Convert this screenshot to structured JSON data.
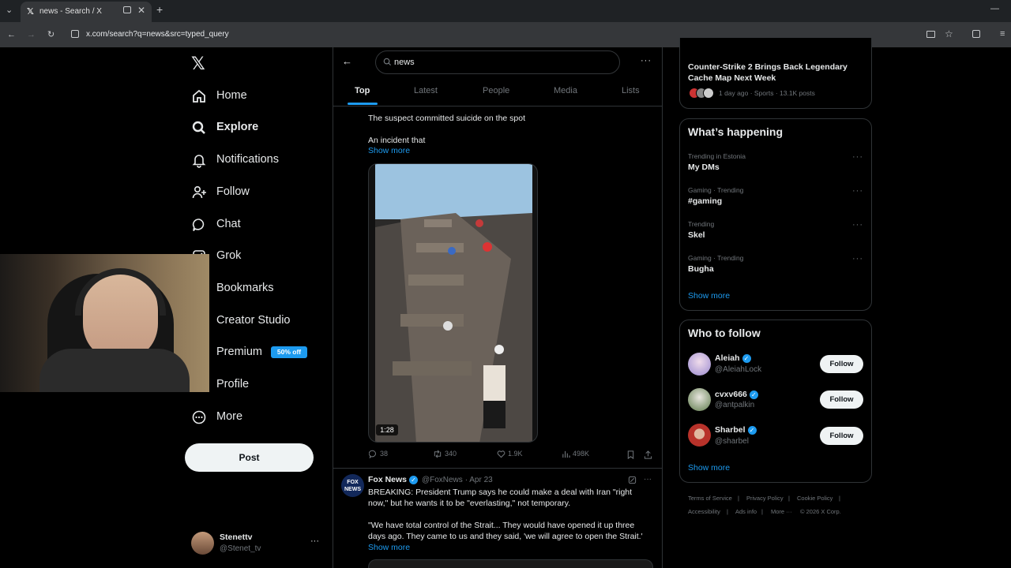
{
  "browser": {
    "tab_title": "news - Search / X",
    "url": "x.com/search?q=news&src=typed_query"
  },
  "nav": {
    "items": [
      {
        "label": "Home",
        "icon": "home-icon"
      },
      {
        "label": "Explore",
        "icon": "search-icon"
      },
      {
        "label": "Notifications",
        "icon": "bell-icon"
      },
      {
        "label": "Follow",
        "icon": "add-person-icon"
      },
      {
        "label": "Chat",
        "icon": "chat-icon"
      },
      {
        "label": "Grok",
        "icon": "grok-icon"
      },
      {
        "label": "Bookmarks",
        "icon": "bookmark-icon"
      },
      {
        "label": "Creator Studio",
        "icon": "creator-studio-icon"
      },
      {
        "label": "Premium",
        "icon": "x-logo-icon"
      },
      {
        "label": "Profile",
        "icon": "person-icon"
      },
      {
        "label": "More",
        "icon": "more-circle-icon"
      }
    ],
    "premium_badge": "50% off",
    "post_button": "Post",
    "account": {
      "name": "Stenettv",
      "handle": "@Stenet_tv",
      "more": "···"
    }
  },
  "search": {
    "query": "news",
    "tabs": [
      "Top",
      "Latest",
      "People",
      "Media",
      "Lists"
    ],
    "active_tab": "Top"
  },
  "tweet1": {
    "line1": "The suspect committed suicide on the spot",
    "line2": "An incident that",
    "show_more": "Show more",
    "video_duration": "1:28",
    "replies": "38",
    "reposts": "340",
    "likes": "1.9K",
    "views": "498K"
  },
  "tweet2": {
    "author": "Fox News",
    "handle": "@FoxNews",
    "date": "· Apr 23",
    "avatar_text": "FOX NEWS",
    "line1": "BREAKING: President Trump says he could make a deal with Iran \"right",
    "line2": "now,\" but he wants it to be \"everlasting,\" not temporary.",
    "line3": "\"We have total control of the Strait... They would have opened it up three",
    "line4": "days ago. They came to us and they said, 'we will agree to open the Strait.'",
    "show_more": "Show more"
  },
  "sidebar": {
    "top_story": {
      "title_line1": "Counter-Strike 2 Brings Back Legendary",
      "title_line2": "Cache Map Next Week",
      "meta": "1 day ago · Sports · 13.1K posts"
    },
    "whats_happening": {
      "title": "What’s happening",
      "trends": [
        {
          "meta": "Trending in Estonia",
          "name": "My DMs"
        },
        {
          "meta": "Gaming · Trending",
          "name": "#gaming"
        },
        {
          "meta": "Trending",
          "name": "Skel"
        },
        {
          "meta": "Gaming · Trending",
          "name": "Bugha"
        }
      ],
      "show_more": "Show more"
    },
    "who_to_follow": {
      "title": "Who to follow",
      "users": [
        {
          "name": "Aleiah",
          "handle": "@AleiahLock",
          "button": "Follow",
          "avatar_color": "#b9a6d8"
        },
        {
          "name": "cvxv666",
          "handle": "@antpalkin",
          "button": "Follow",
          "avatar_color": "#6f8a5a"
        },
        {
          "name": "Sharbel",
          "handle": "@sharbel",
          "button": "Follow",
          "avatar_color": "#b8322a"
        }
      ],
      "show_more": "Show more"
    },
    "footer": {
      "links_row1": [
        "Terms of Service",
        "|",
        "Privacy Policy",
        "|",
        "Cookie Policy",
        "|"
      ],
      "links_row2": [
        "Accessibility",
        "|",
        "Ads info",
        "|",
        "More ···",
        "© 2026 X Corp."
      ]
    }
  },
  "colors": {
    "accent": "#1d9bf0",
    "background": "#000000",
    "border": "#2f3336",
    "muted": "#71767b"
  }
}
